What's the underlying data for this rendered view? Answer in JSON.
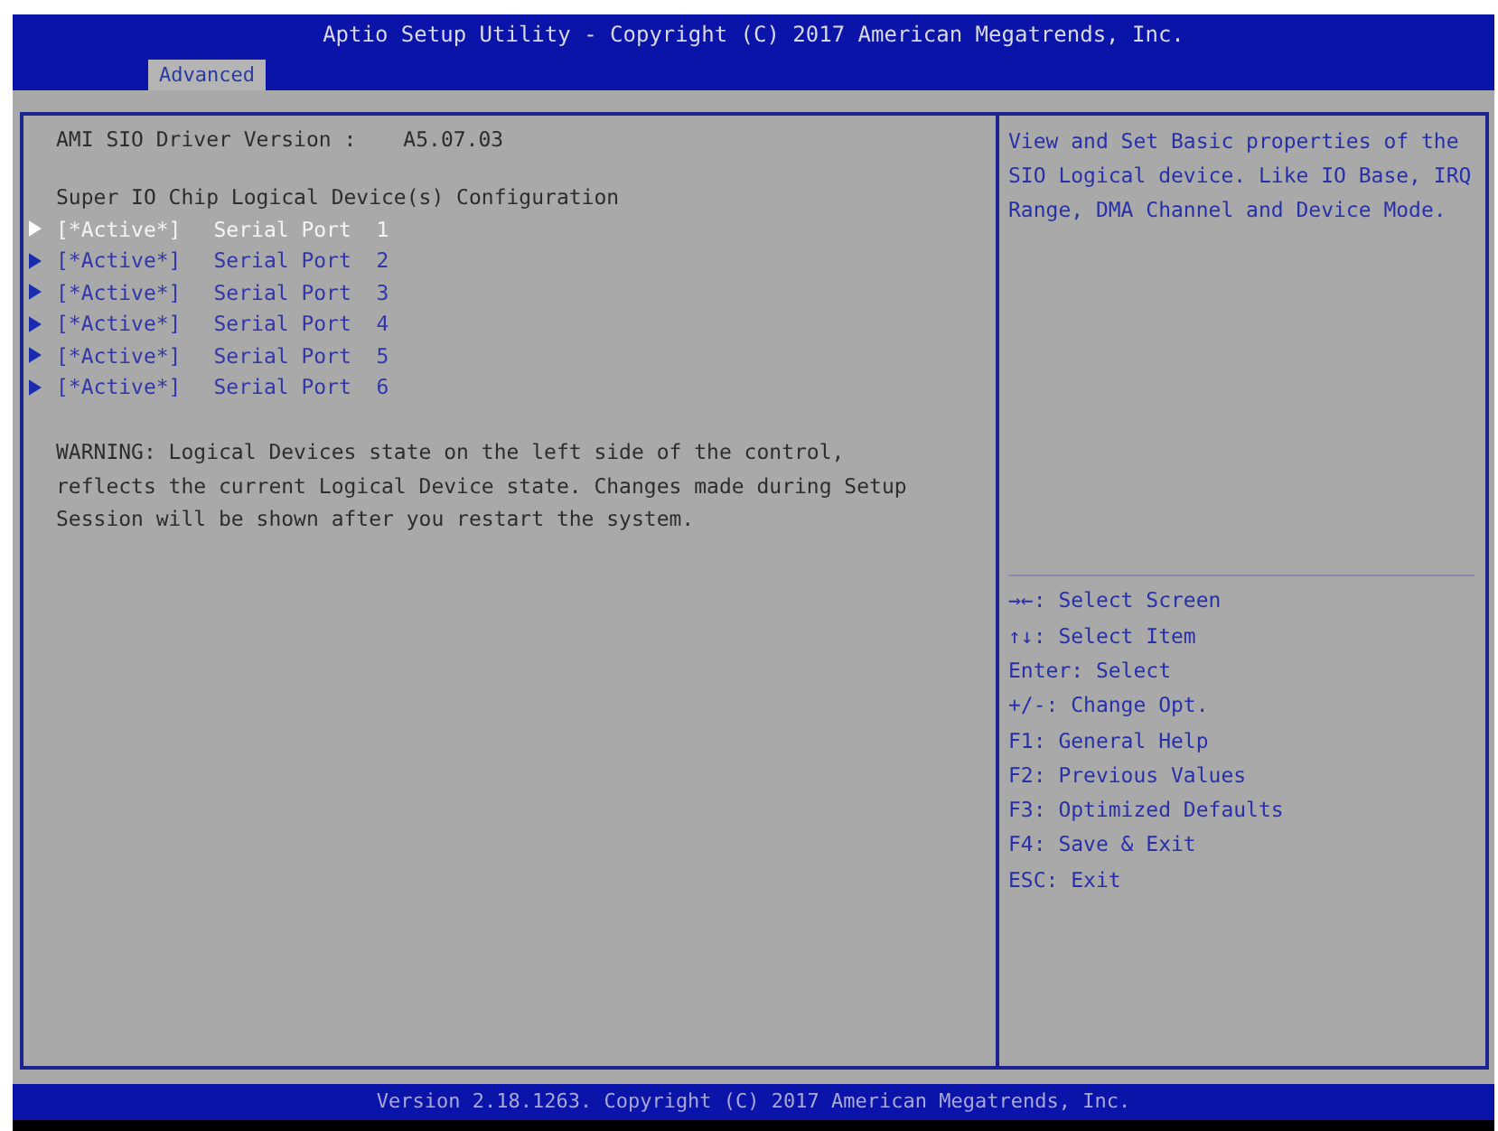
{
  "header": {
    "title": "Aptio Setup Utility - Copyright (C) 2017 American Megatrends, Inc.",
    "tabs": [
      {
        "label": "Advanced",
        "selected": true
      }
    ]
  },
  "main": {
    "version_label": "AMI SIO Driver Version :",
    "version_value": "A5.07.03",
    "section_title": "Super IO Chip Logical Device(s) Configuration",
    "items": [
      {
        "status": "[*Active*]",
        "label": "Serial Port  1",
        "selected": true
      },
      {
        "status": "[*Active*]",
        "label": "Serial Port  2",
        "selected": false
      },
      {
        "status": "[*Active*]",
        "label": "Serial Port  3",
        "selected": false
      },
      {
        "status": "[*Active*]",
        "label": "Serial Port  4",
        "selected": false
      },
      {
        "status": "[*Active*]",
        "label": "Serial Port  5",
        "selected": false
      },
      {
        "status": "[*Active*]",
        "label": "Serial Port  6",
        "selected": false
      }
    ],
    "warning": "WARNING: Logical Devices state on the left side of the control, reflects the current Logical Device state. Changes made during Setup Session will be shown after you restart the system."
  },
  "help": {
    "description": "View and Set Basic properties of the SIO Logical device. Like IO Base, IRQ Range, DMA Channel and Device Mode.",
    "keys": [
      "→←: Select Screen",
      "↑↓: Select Item",
      "Enter: Select",
      "+/-: Change Opt.",
      "F1: General Help",
      "F2: Previous Values",
      "F3: Optimized Defaults",
      "F4: Save & Exit",
      "ESC: Exit"
    ]
  },
  "footer": "Version 2.18.1263. Copyright (C) 2017 American Megatrends, Inc."
}
